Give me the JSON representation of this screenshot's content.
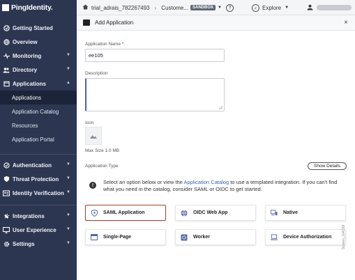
{
  "brand": {
    "name": "PingIdentity."
  },
  "sidebar": {
    "items": [
      {
        "label": "Getting Started",
        "icon": "rocket-icon",
        "chevron": false
      },
      {
        "label": "Overview",
        "icon": "globe-icon",
        "chevron": false
      },
      {
        "label": "Monitoring",
        "icon": "pulse-icon",
        "chevron": true
      },
      {
        "label": "Directory",
        "icon": "users-icon",
        "chevron": true
      },
      {
        "label": "Applications",
        "icon": "app-window-icon",
        "chevron": true,
        "expanded": true
      }
    ],
    "sub_items": [
      {
        "label": "Applications",
        "active": true
      },
      {
        "label": "Application Catalog",
        "active": false
      },
      {
        "label": "Resources",
        "active": false
      },
      {
        "label": "Application Portal",
        "active": false
      }
    ],
    "items_group2": [
      {
        "label": "Authentication",
        "icon": "check-circle-icon"
      },
      {
        "label": "Threat Protection",
        "icon": "shield-icon"
      },
      {
        "label": "Identity Verification",
        "icon": "id-card-icon"
      }
    ],
    "items_group3": [
      {
        "label": "Integrations",
        "icon": "plug-icon"
      },
      {
        "label": "User Experience",
        "icon": "monitor-icon"
      },
      {
        "label": "Settings",
        "icon": "gear-icon"
      }
    ]
  },
  "topbar": {
    "environment": "trial_adrais_782267493",
    "customer": "Custome...",
    "badge": "SANDBOX",
    "help": "?",
    "explore": "Explore"
  },
  "panel": {
    "title": "Add Application",
    "close": "×"
  },
  "form": {
    "app_name_label": "Application Name",
    "required_mark": "*",
    "app_name_value": "ee105",
    "description_label": "Description",
    "icon_label": "Icon",
    "max_size": "Max Size 1.0 MB",
    "app_type_label": "Application Type",
    "show_details": "Show Details",
    "info_prefix": "Select an option below or view the ",
    "info_link": "Application Catalog",
    "info_suffix": " to use a templated integration. If you can't find what you need in the catalog, consider SAML or OIDC to get started."
  },
  "app_types": [
    {
      "label": "SAML Application",
      "icon": "shield-icon",
      "selected": true
    },
    {
      "label": "OIDC Web App",
      "icon": "globe-icon",
      "selected": false
    },
    {
      "label": "Native",
      "icon": "devices-icon",
      "selected": false
    },
    {
      "label": "Single-Page",
      "icon": "browser-icon",
      "selected": false
    },
    {
      "label": "Worker",
      "icon": "gear-icon",
      "selected": false
    },
    {
      "label": "Device Authorization",
      "icon": "laptop-icon",
      "selected": false
    }
  ],
  "screen_id": "Screen_Gt4Z69",
  "colors": {
    "sidebar": "#2c3651",
    "accent": "#3c5bc4",
    "selected_border": "#a1482a"
  }
}
